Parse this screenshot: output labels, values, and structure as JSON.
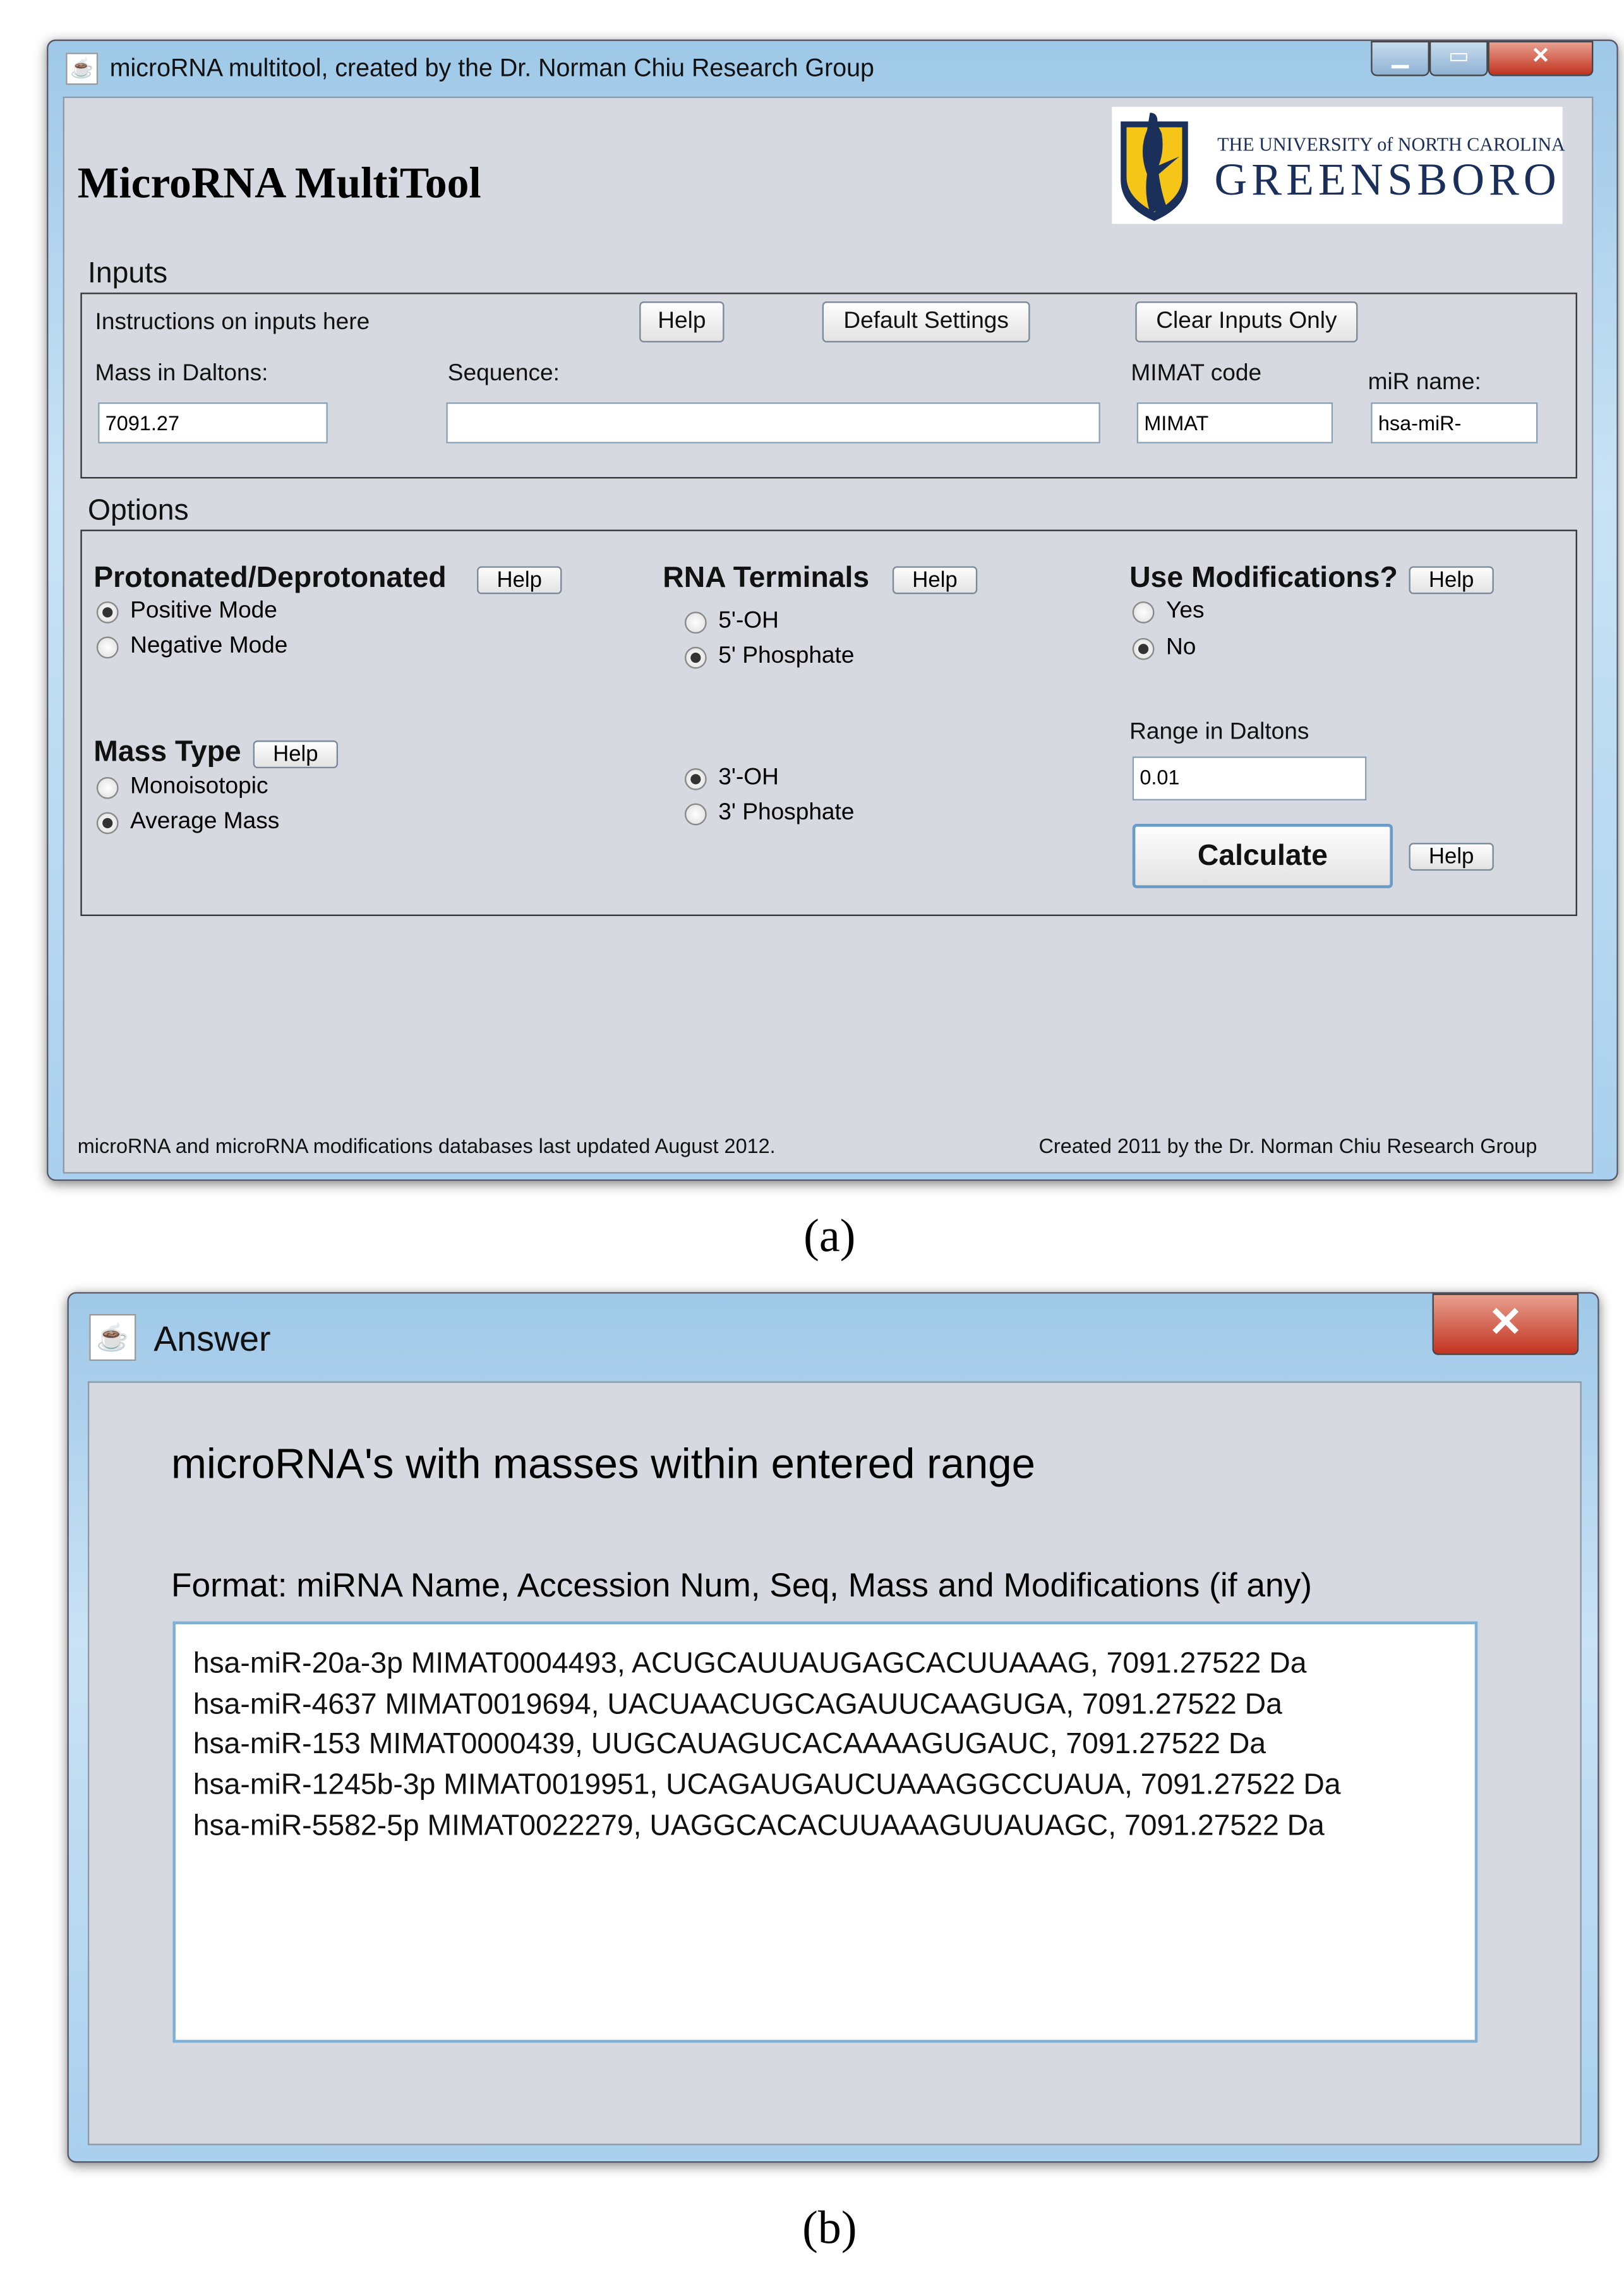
{
  "main_window": {
    "title": "microRNA multitool, created by the Dr. Norman Chiu Research Group",
    "app_heading": "MicroRNA MultiTool",
    "logo": {
      "line1": "THE UNIVERSITY of NORTH CAROLINA",
      "line2": "GREENSBORO",
      "colors": {
        "navy": "#1a2f5a",
        "gold": "#f5c518"
      }
    },
    "inputs": {
      "section_label": "Inputs",
      "instructions": "Instructions on inputs here",
      "help_label": "Help",
      "default_settings_label": "Default Settings",
      "clear_inputs_label": "Clear Inputs Only",
      "mass_label": "Mass in Daltons:",
      "mass_value": "7091.27",
      "sequence_label": "Sequence:",
      "sequence_value": "",
      "mimat_label": "MIMAT code",
      "mimat_value": "MIMAT",
      "mir_name_label": "miR name:",
      "mir_name_value": "hsa-miR-"
    },
    "options": {
      "section_label": "Options",
      "protonation": {
        "title": "Protonated/Deprotonated",
        "help": "Help",
        "options": [
          "Positive Mode",
          "Negative Mode"
        ],
        "selected": "Positive Mode"
      },
      "mass_type": {
        "title": "Mass Type",
        "help": "Help",
        "options": [
          "Monoisotopic",
          "Average Mass"
        ],
        "selected": "Average Mass"
      },
      "rna_terminals": {
        "title": "RNA Terminals",
        "help": "Help",
        "five_prime": [
          "5'-OH",
          "5' Phosphate"
        ],
        "five_selected": "5' Phosphate",
        "three_prime": [
          "3'-OH",
          "3' Phosphate"
        ],
        "three_selected": "3'-OH"
      },
      "modifications": {
        "title": "Use Modifications?",
        "help": "Help",
        "options": [
          "Yes",
          "No"
        ],
        "selected": "No"
      },
      "range_label": "Range in Daltons",
      "range_value": "0.01",
      "calculate_label": "Calculate",
      "calculate_help": "Help"
    },
    "footer_left": "microRNA and microRNA modifications databases last updated August 2012.",
    "footer_right": "Created 2011 by the Dr. Norman Chiu Research Group"
  },
  "caption_a": "(a)",
  "answer_window": {
    "title": "Answer",
    "heading": "microRNA's with masses within entered range",
    "format": "Format: miRNA Name, Accession Num, Seq, Mass and Modifications (if any)",
    "results": [
      "hsa-miR-20a-3p MIMAT0004493, ACUGCAUUAUGAGCACUUAAAG, 7091.27522 Da",
      "hsa-miR-4637 MIMAT0019694, UACUAACUGCAGAUUCAAGUGA, 7091.27522 Da",
      "hsa-miR-153 MIMAT0000439, UUGCAUAGUCACAAAAGUGAUC, 7091.27522 Da",
      "hsa-miR-1245b-3p MIMAT0019951, UCAGAUGAUCUAAAGGCCUAUA, 7091.27522 Da",
      "hsa-miR-5582-5p MIMAT0022279, UAGGCACACUUAAAGUUAUAGC, 7091.27522 Da"
    ]
  },
  "caption_b": "(b)"
}
